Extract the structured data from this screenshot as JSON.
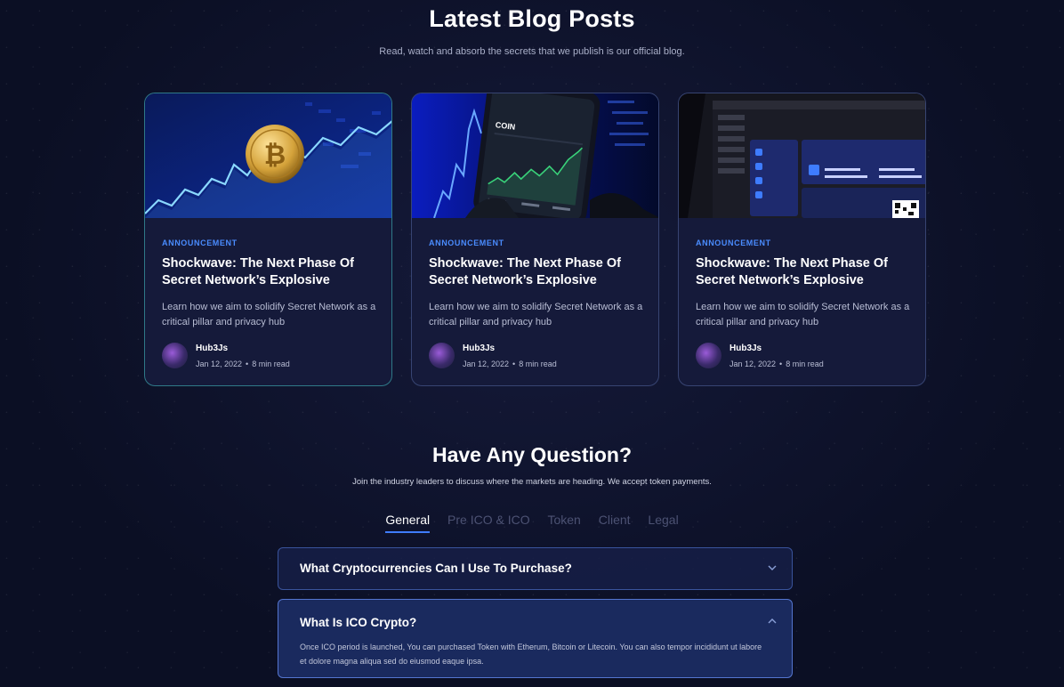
{
  "blog": {
    "title": "Latest Blog Posts",
    "subtitle": "Read, watch and absorb the secrets that we publish is our official blog.",
    "posts": [
      {
        "tag": "ANNOUNCEMENT",
        "title": "Shockwave: The Next Phase Of Secret Network’s Explosive",
        "description": "Learn how we aim to solidify Secret Network as a critical pillar and privacy hub",
        "author": "Hub3Js",
        "date": "Jan 12, 2022",
        "read_time": "8 min read",
        "image": "bitcoin-coin-chart"
      },
      {
        "tag": "ANNOUNCEMENT",
        "title": "Shockwave: The Next Phase Of Secret Network’s Explosive",
        "description": "Learn how we aim to solidify Secret Network as a critical pillar and privacy hub",
        "author": "Hub3Js",
        "date": "Jan 12, 2022",
        "read_time": "8 min read",
        "image": "phone-trading-app",
        "phone_ticker": "COIN"
      },
      {
        "tag": "ANNOUNCEMENT",
        "title": "Shockwave: The Next Phase Of Secret Network’s Explosive",
        "description": "Learn how we aim to solidify Secret Network as a critical pillar and privacy hub",
        "author": "Hub3Js",
        "date": "Jan 12, 2022",
        "read_time": "8 min read",
        "image": "laptop-wallet-dashboard"
      }
    ]
  },
  "faq": {
    "title": "Have Any Question?",
    "subtitle": "Join the industry leaders to discuss where the markets are heading. We accept token payments.",
    "tabs": [
      "General",
      "Pre ICO & ICO",
      "Token",
      "Client",
      "Legal"
    ],
    "active_tab": "General",
    "items": [
      {
        "question": "What Cryptocurrencies Can I Use To Purchase?",
        "expanded": false,
        "icon": "chevron-down-icon"
      },
      {
        "question": "What Is ICO Crypto?",
        "expanded": true,
        "icon": "chevron-up-icon",
        "answer": "Once ICO period is launched, You can purchased Token with Etherum, Bitcoin or Litecoin. You can also tempor incididunt ut labore et dolore magna aliqua sed do eiusmod eaque ipsa."
      }
    ]
  },
  "colors": {
    "background": "#0b0f24",
    "card": "#151a3a",
    "accent": "#3f7cff",
    "tag": "#4a8cff"
  }
}
